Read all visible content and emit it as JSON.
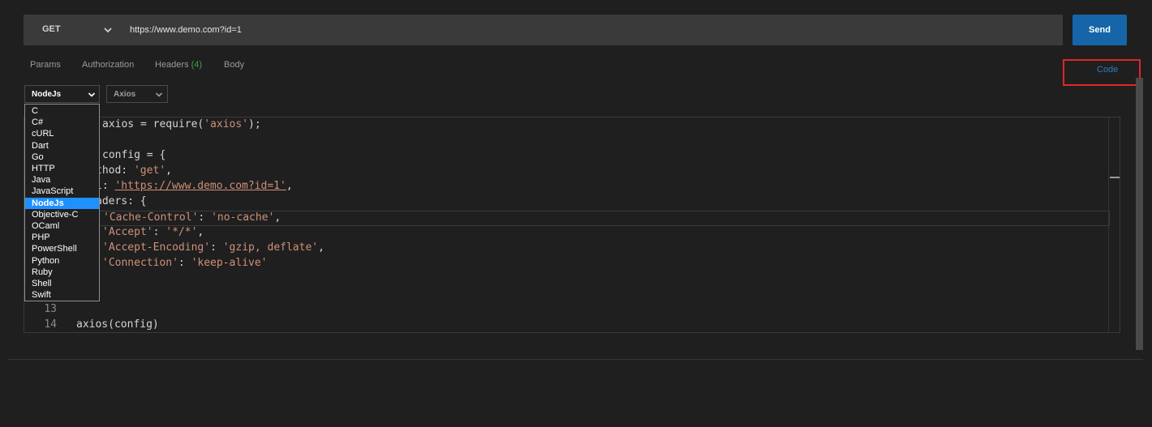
{
  "request": {
    "method": "GET",
    "url": "https://www.demo.com?id=1",
    "send_label": "Send"
  },
  "tabs": [
    {
      "label": "Params"
    },
    {
      "label": "Authorization"
    },
    {
      "label": "Headers",
      "count": "(4)"
    },
    {
      "label": "Body"
    }
  ],
  "code_link": "Code",
  "language_select": {
    "selected": "NodeJs",
    "options": [
      "C",
      "C#",
      "cURL",
      "Dart",
      "Go",
      "HTTP",
      "Java",
      "JavaScript",
      "NodeJs",
      "Objective-C",
      "OCaml",
      "PHP",
      "PowerShell",
      "Python",
      "Ruby",
      "Shell",
      "Swift"
    ]
  },
  "library_select": {
    "selected": "Axios"
  },
  "editor": {
    "lines": [
      {
        "num": "",
        "html": "axios = require(<span class=\"str\">'axios'</span>);",
        "offset": 32
      },
      {
        "num": "",
        "html": "",
        "offset": 32
      },
      {
        "num": "",
        "html": "config = {",
        "offset": 32
      },
      {
        "num": "",
        "html": "thod: <span class=\"str\">'get'</span>,",
        "offset": 24
      },
      {
        "num": "",
        "html": "l: <span class=\"url-str\">'https://www.demo.com?id=1'</span>,",
        "offset": 24
      },
      {
        "num": "",
        "html": "aders: {",
        "offset": 24
      },
      {
        "num": "",
        "html": "<span class=\"str\">'Cache-Control'</span>: <span class=\"str\">'no-cache'</span>,",
        "offset": 32,
        "active": true
      },
      {
        "num": "",
        "html": "<span class=\"str\">'Accept'</span>: <span class=\"str\">'*/*'</span>,",
        "offset": 32
      },
      {
        "num": "",
        "html": "<span class=\"str\">'Accept-Encoding'</span>: <span class=\"str\">'gzip, deflate'</span>,",
        "offset": 32
      },
      {
        "num": "",
        "html": "<span class=\"str\">'Connection'</span>: <span class=\"str\">'keep-alive'</span>",
        "offset": 32
      },
      {
        "num": "",
        "html": "",
        "offset": 0
      },
      {
        "num": "",
        "html": "",
        "offset": 0
      },
      {
        "num": "13",
        "html": "",
        "offset": 0
      },
      {
        "num": "14",
        "html": "axios(config)",
        "offset": 0
      }
    ]
  },
  "icons": {
    "method_chevron": "chevron-down-icon",
    "select_chevron": "chevron-down-icon"
  },
  "colors": {
    "send_button": "#1565a8",
    "selected_option": "#1e90ff",
    "headers_count": "#3ea34a",
    "highlight_box": "#e32525",
    "string_literal": "#ce9178"
  }
}
